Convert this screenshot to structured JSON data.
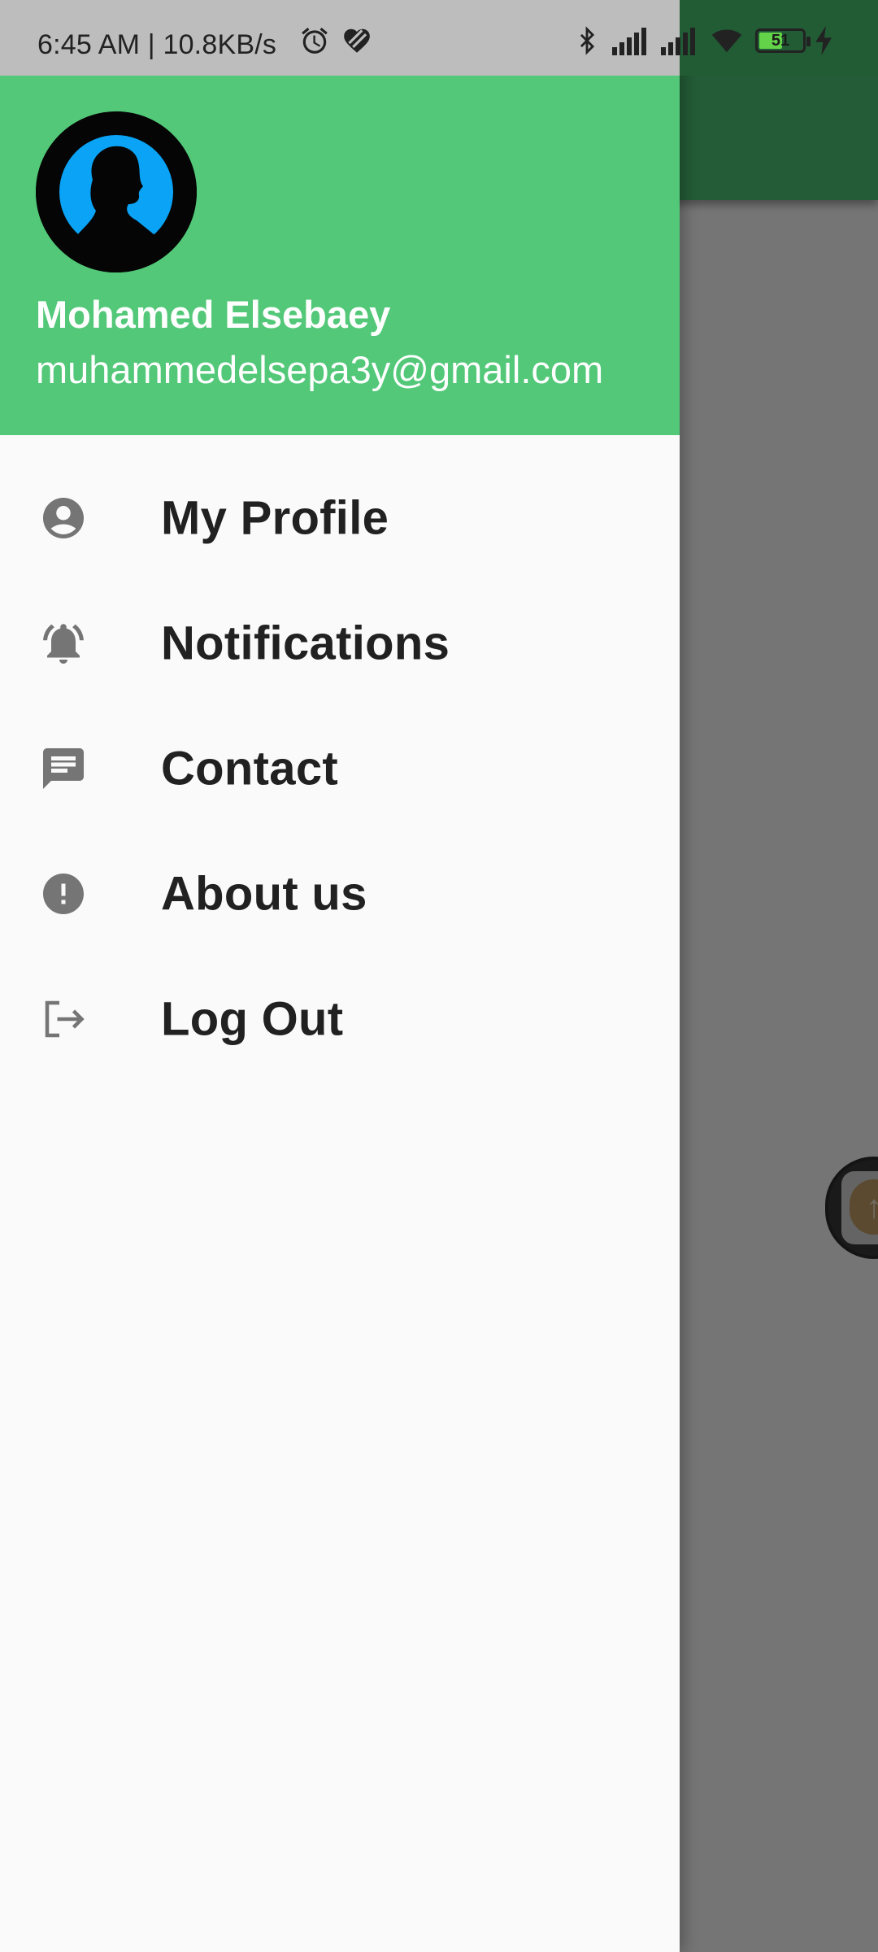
{
  "status_bar": {
    "time_speed": "6:45 AM | 10.8KB/s",
    "battery_level": "51",
    "icons": [
      "alarm-icon",
      "heart-icon",
      "bluetooth-icon",
      "signal-icon",
      "signal-icon",
      "wifi-icon",
      "battery-icon",
      "charging-icon"
    ]
  },
  "drawer": {
    "header": {
      "name": "Mohamed Elsebaey",
      "email": "muhammedelsepa3y@gmail.com",
      "background": "#52C878"
    },
    "items": [
      {
        "label": "My Profile",
        "icon": "account-circle-icon"
      },
      {
        "label": "Notifications",
        "icon": "bell-ringing-icon"
      },
      {
        "label": "Contact",
        "icon": "message-icon"
      },
      {
        "label": "About us",
        "icon": "exclamation-icon"
      },
      {
        "label": "Log Out",
        "icon": "logout-icon"
      }
    ]
  },
  "colors": {
    "accent": "#52C878",
    "icon": "#757575",
    "text": "#212121"
  }
}
